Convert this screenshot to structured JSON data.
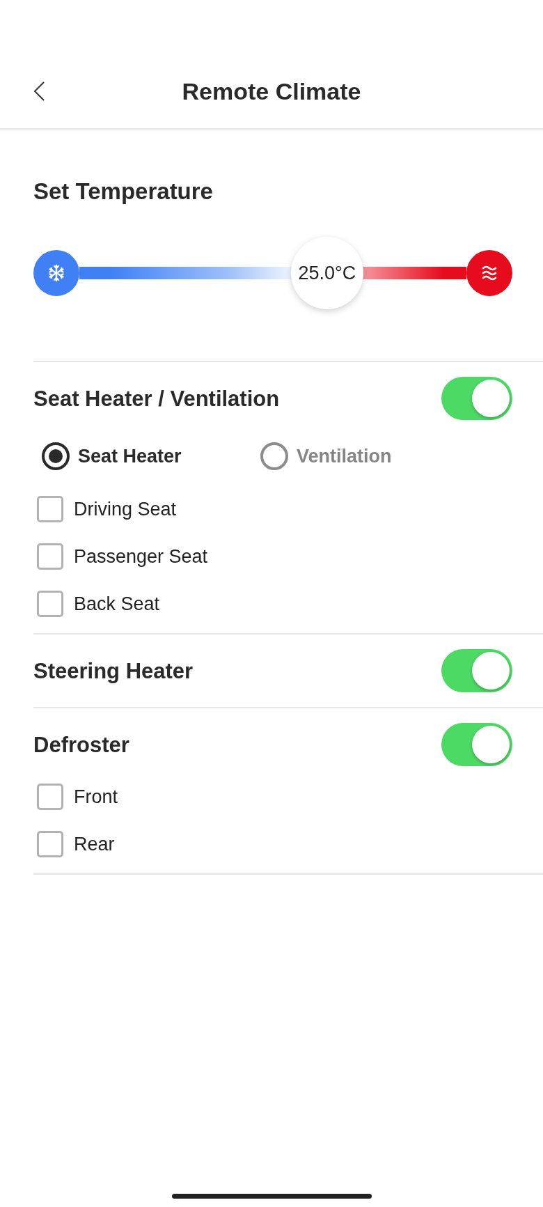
{
  "header": {
    "title": "Remote Climate"
  },
  "temperature": {
    "title": "Set Temperature",
    "level": 0.64,
    "reading": "25.0°C"
  },
  "sections": [
    {
      "title": "Seat Heater / Ventilation",
      "on": true,
      "modes": [
        {
          "label": "Seat Heater",
          "selected": true
        },
        {
          "label": "Ventilation",
          "selected": false
        }
      ],
      "options": [
        {
          "label": "Driving Seat",
          "checked": false
        },
        {
          "label": "Passenger Seat",
          "checked": false
        },
        {
          "label": "Back Seat",
          "checked": false
        }
      ]
    },
    {
      "title": "Steering Heater",
      "on": true
    },
    {
      "title": "Defroster",
      "on": true,
      "options": [
        {
          "label": "Front",
          "checked": false
        },
        {
          "label": "Rear",
          "checked": false
        }
      ]
    }
  ]
}
